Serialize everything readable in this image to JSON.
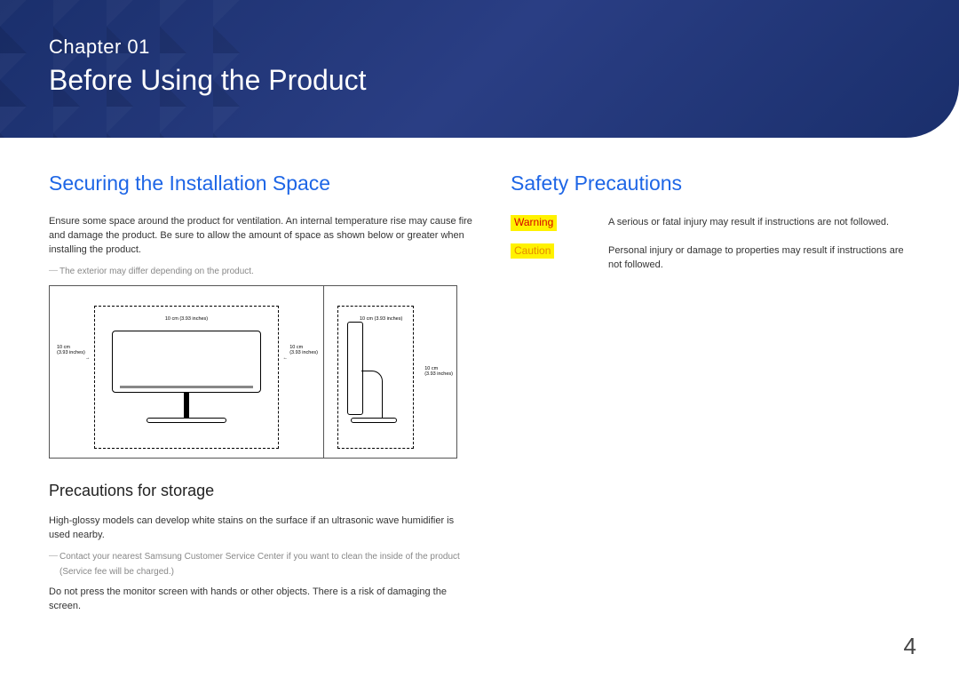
{
  "banner": {
    "chapter_label": "Chapter 01",
    "chapter_title": "Before Using the Product"
  },
  "left": {
    "heading": "Securing the Installation Space",
    "intro": "Ensure some space around the product for ventilation. An internal temperature rise may cause fire and damage the product. Be sure to allow the amount of space as shown below or greater when installing the product.",
    "note1": "The exterior may differ depending on the product.",
    "sub_heading": "Precautions for storage",
    "storage1": "High-glossy models can develop white stains on the surface if an ultrasonic wave humidifier is used nearby.",
    "storage_note": "Contact your nearest Samsung Customer Service Center if you want to clean the inside of the product",
    "storage_note_sub": "(Service fee will be charged.)",
    "storage2": "Do not press the monitor screen with hands or other objects. There is a risk of damaging the screen."
  },
  "diagram": {
    "top": "10 cm (3.93 inches)",
    "left_label": "10 cm",
    "left_sub": "(3.93 inches)",
    "right_label": "10 cm",
    "right_sub": "(3.93 inches)",
    "side_top": "10 cm (3.93 inches)",
    "side_back": "10 cm",
    "side_back_sub": "(3.93 inches)"
  },
  "right": {
    "heading": "Safety Precautions",
    "warning_label": "Warning",
    "warning_text": "A serious or fatal injury may result if instructions are not followed.",
    "caution_label": "Caution",
    "caution_text": "Personal injury or damage to properties may result if instructions are not followed."
  },
  "page_number": "4"
}
